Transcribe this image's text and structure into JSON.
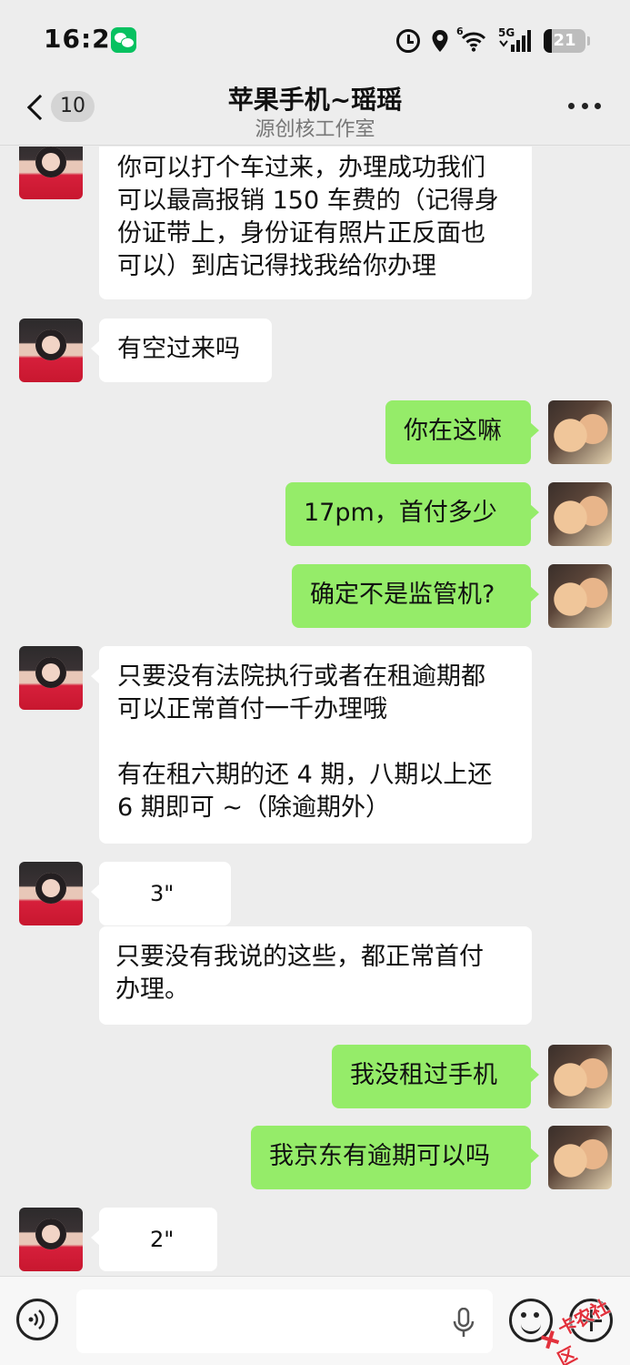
{
  "status_bar": {
    "time": "16:21",
    "battery": "21",
    "network": "5G",
    "wifi_badge": "6"
  },
  "header": {
    "unread_count": "10",
    "title": "苹果手机~瑶瑶",
    "subtitle": "源创核工作室"
  },
  "messages": [
    {
      "side": "in",
      "type": "text",
      "text": "你可以打个车过来，办理成功我们\n可以最高报销 150 车费的（记得身\n份证带上，身份证有照片正反面也\n可以）到店记得找我给你办理"
    },
    {
      "side": "in",
      "type": "text",
      "text": "有空过来吗"
    },
    {
      "side": "out",
      "type": "text",
      "text": "你在这嘛"
    },
    {
      "side": "out",
      "type": "text",
      "text": "17pm，首付多少"
    },
    {
      "side": "out",
      "type": "text",
      "text": "确定不是监管机?"
    },
    {
      "side": "in",
      "type": "text",
      "text": "只要没有法院执行或者在租逾期都\n可以正常首付一千办理哦\n\n有在租六期的还 4 期，八期以上还\n6 期即可 ~（除逾期外）"
    },
    {
      "side": "in",
      "type": "voice",
      "duration": "3\""
    },
    {
      "side": "in",
      "type": "text",
      "text": "只要没有我说的这些，都正常首付\n办理。"
    },
    {
      "side": "out",
      "type": "text",
      "text": "我没租过手机"
    },
    {
      "side": "out",
      "type": "text",
      "text": "我京东有逾期可以吗"
    },
    {
      "side": "in",
      "type": "voice",
      "duration": "2\""
    }
  ],
  "input": {
    "placeholder": ""
  },
  "watermark": "卡农社区",
  "colors": {
    "background": "#ededed",
    "outgoing_bubble": "#95ec69",
    "incoming_bubble": "#ffffff",
    "wechat_green": "#07c160"
  }
}
